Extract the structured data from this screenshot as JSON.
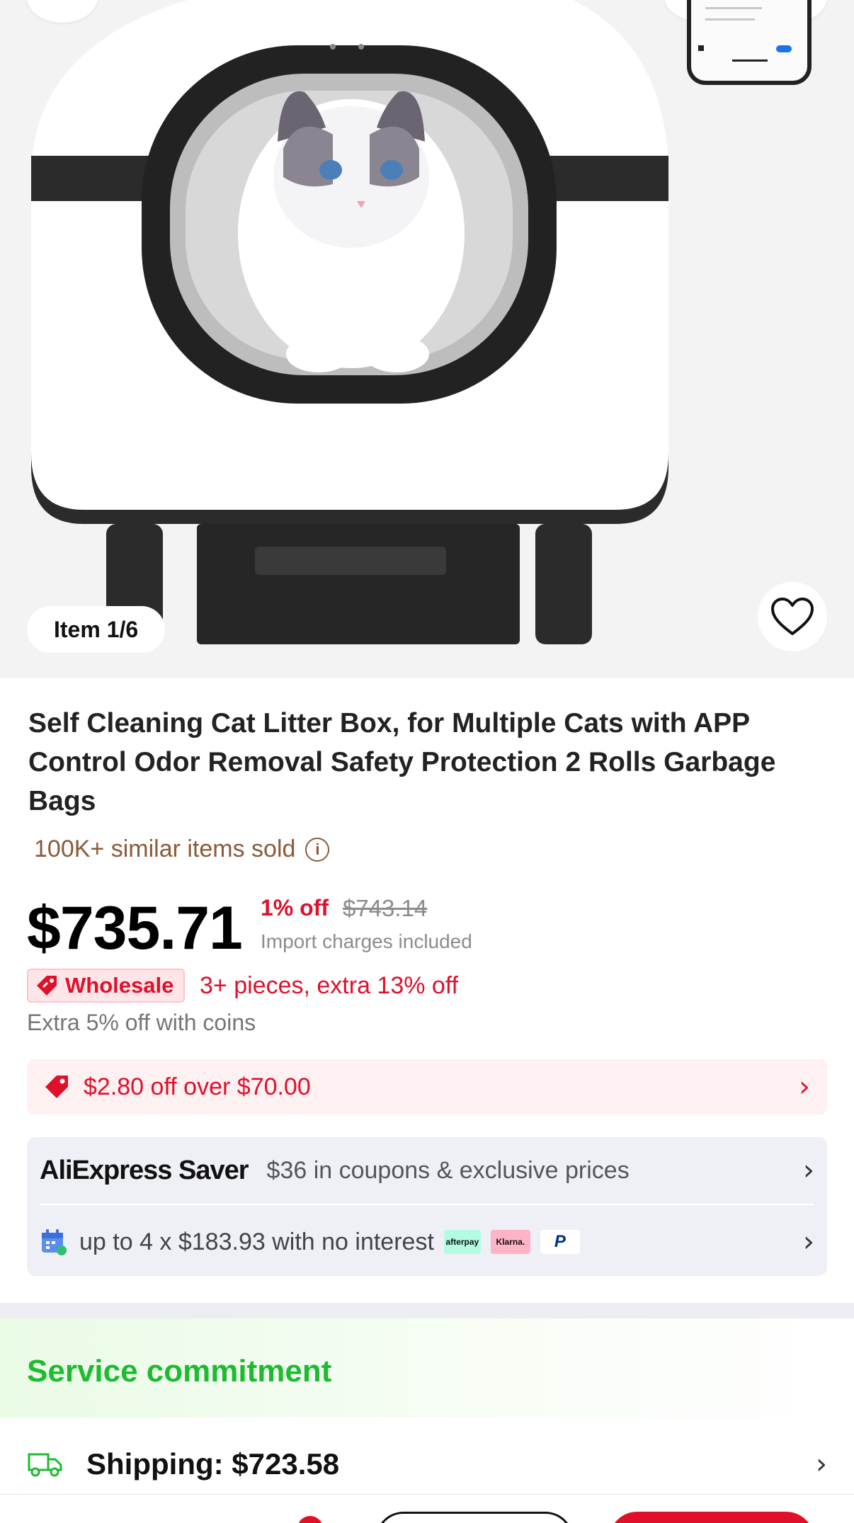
{
  "gallery": {
    "counter": "Item 1/6"
  },
  "product": {
    "title": "Self Cleaning Cat Litter Box, for Multiple Cats with APP Control Odor Removal Safety Protection 2 Rolls Garbage Bags",
    "sold": "100K+ similar items sold",
    "price": "$735.71",
    "discount": "1% off",
    "original_price": "$743.14",
    "import_note": "Import charges included",
    "wholesale_label": "Wholesale",
    "wholesale_offer": "3+ pieces, extra 13% off",
    "coins_offer": "Extra 5% off with coins"
  },
  "coupon": {
    "text": "$2.80 off over $70.00"
  },
  "saver": {
    "logo": "AliExpress Saver",
    "text": "$36 in coupons & exclusive prices"
  },
  "installments": {
    "text": "up to 4 x $183.93 with no interest",
    "providers": [
      "afterpay",
      "Klarna.",
      "P"
    ]
  },
  "service": {
    "title": "Service commitment",
    "shipping": "Shipping: $723.58"
  },
  "colors": {
    "accent_red": "#e0102b",
    "service_green": "#1dbb2f",
    "sold_brown": "#8a5a3a"
  },
  "icons": {
    "back": "back-arrow-icon",
    "search": "search-icon",
    "share": "share-icon",
    "wishlist": "heart-icon",
    "info": "info-icon",
    "wholesale": "tag-icon",
    "coupon": "coupon-tag-icon",
    "calendar": "calendar-icon",
    "shipping": "truck-icon",
    "chevron": "chevron-right-icon"
  }
}
